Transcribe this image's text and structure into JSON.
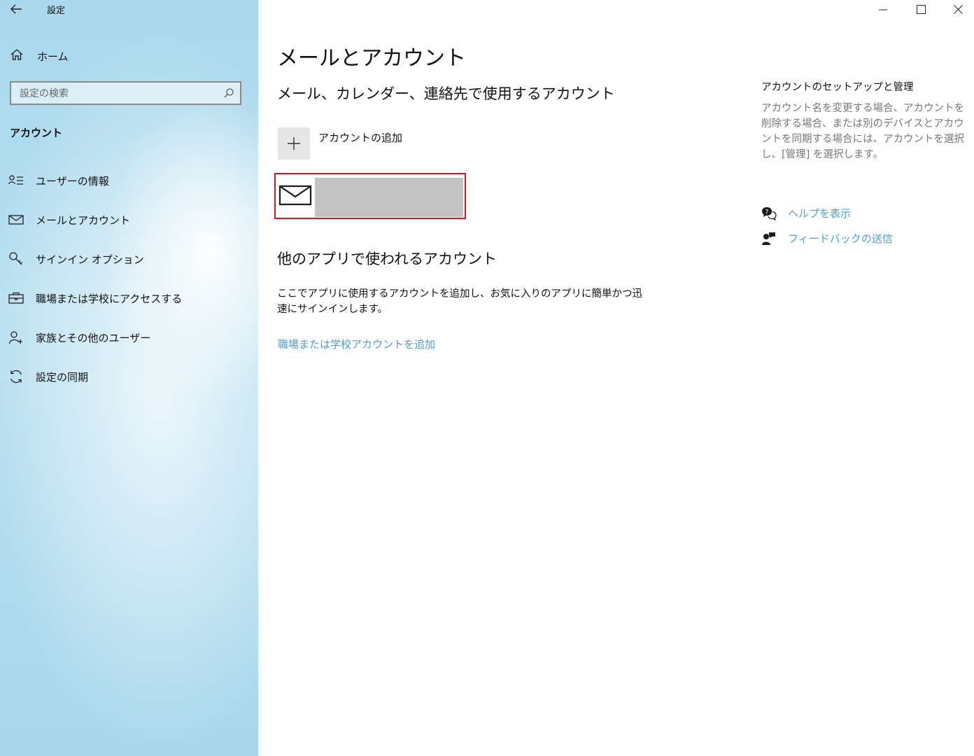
{
  "window": {
    "title": "設定",
    "controls": [
      "minimize-icon",
      "maximize-icon",
      "close-icon"
    ]
  },
  "sidebar": {
    "home_label": "ホーム",
    "search_placeholder": "設定の検索",
    "section_title": "アカウント",
    "items": [
      {
        "label": "ユーザーの情報",
        "icon": "user-info-icon"
      },
      {
        "label": "メールとアカウント",
        "icon": "mail-icon"
      },
      {
        "label": "サインイン オプション",
        "icon": "key-icon"
      },
      {
        "label": "職場または学校にアクセスする",
        "icon": "briefcase-icon"
      },
      {
        "label": "家族とその他のユーザー",
        "icon": "add-user-icon"
      },
      {
        "label": "設定の同期",
        "icon": "sync-icon"
      }
    ]
  },
  "main": {
    "title": "メールとアカウント",
    "subtitle": "メール、カレンダー、連絡先で使用するアカウント",
    "add_account_label": "アカウントの追加",
    "other_title": "他のアプリで使われるアカウント",
    "other_desc": "ここでアプリに使用するアカウントを追加し、お気に入りのアプリに簡単かつ迅速にサインインします。",
    "add_work_link": "職場または学校アカウントを追加"
  },
  "right_pane": {
    "title": "アカウントのセットアップと管理",
    "desc": "アカウント名を変更する場合、アカウントを削除する場合、または別のデバイスとアカウントを同期する場合には、アカウントを選択し、[管理] を選択します。",
    "help_link": "ヘルプを表示",
    "feedback_link": "フィードバックの送信"
  },
  "colors": {
    "sidebar_bg": "#a9d8ec",
    "link": "#4a9fd8",
    "highlight_border": "#e0141e",
    "redacted": "#c2c2c2"
  }
}
